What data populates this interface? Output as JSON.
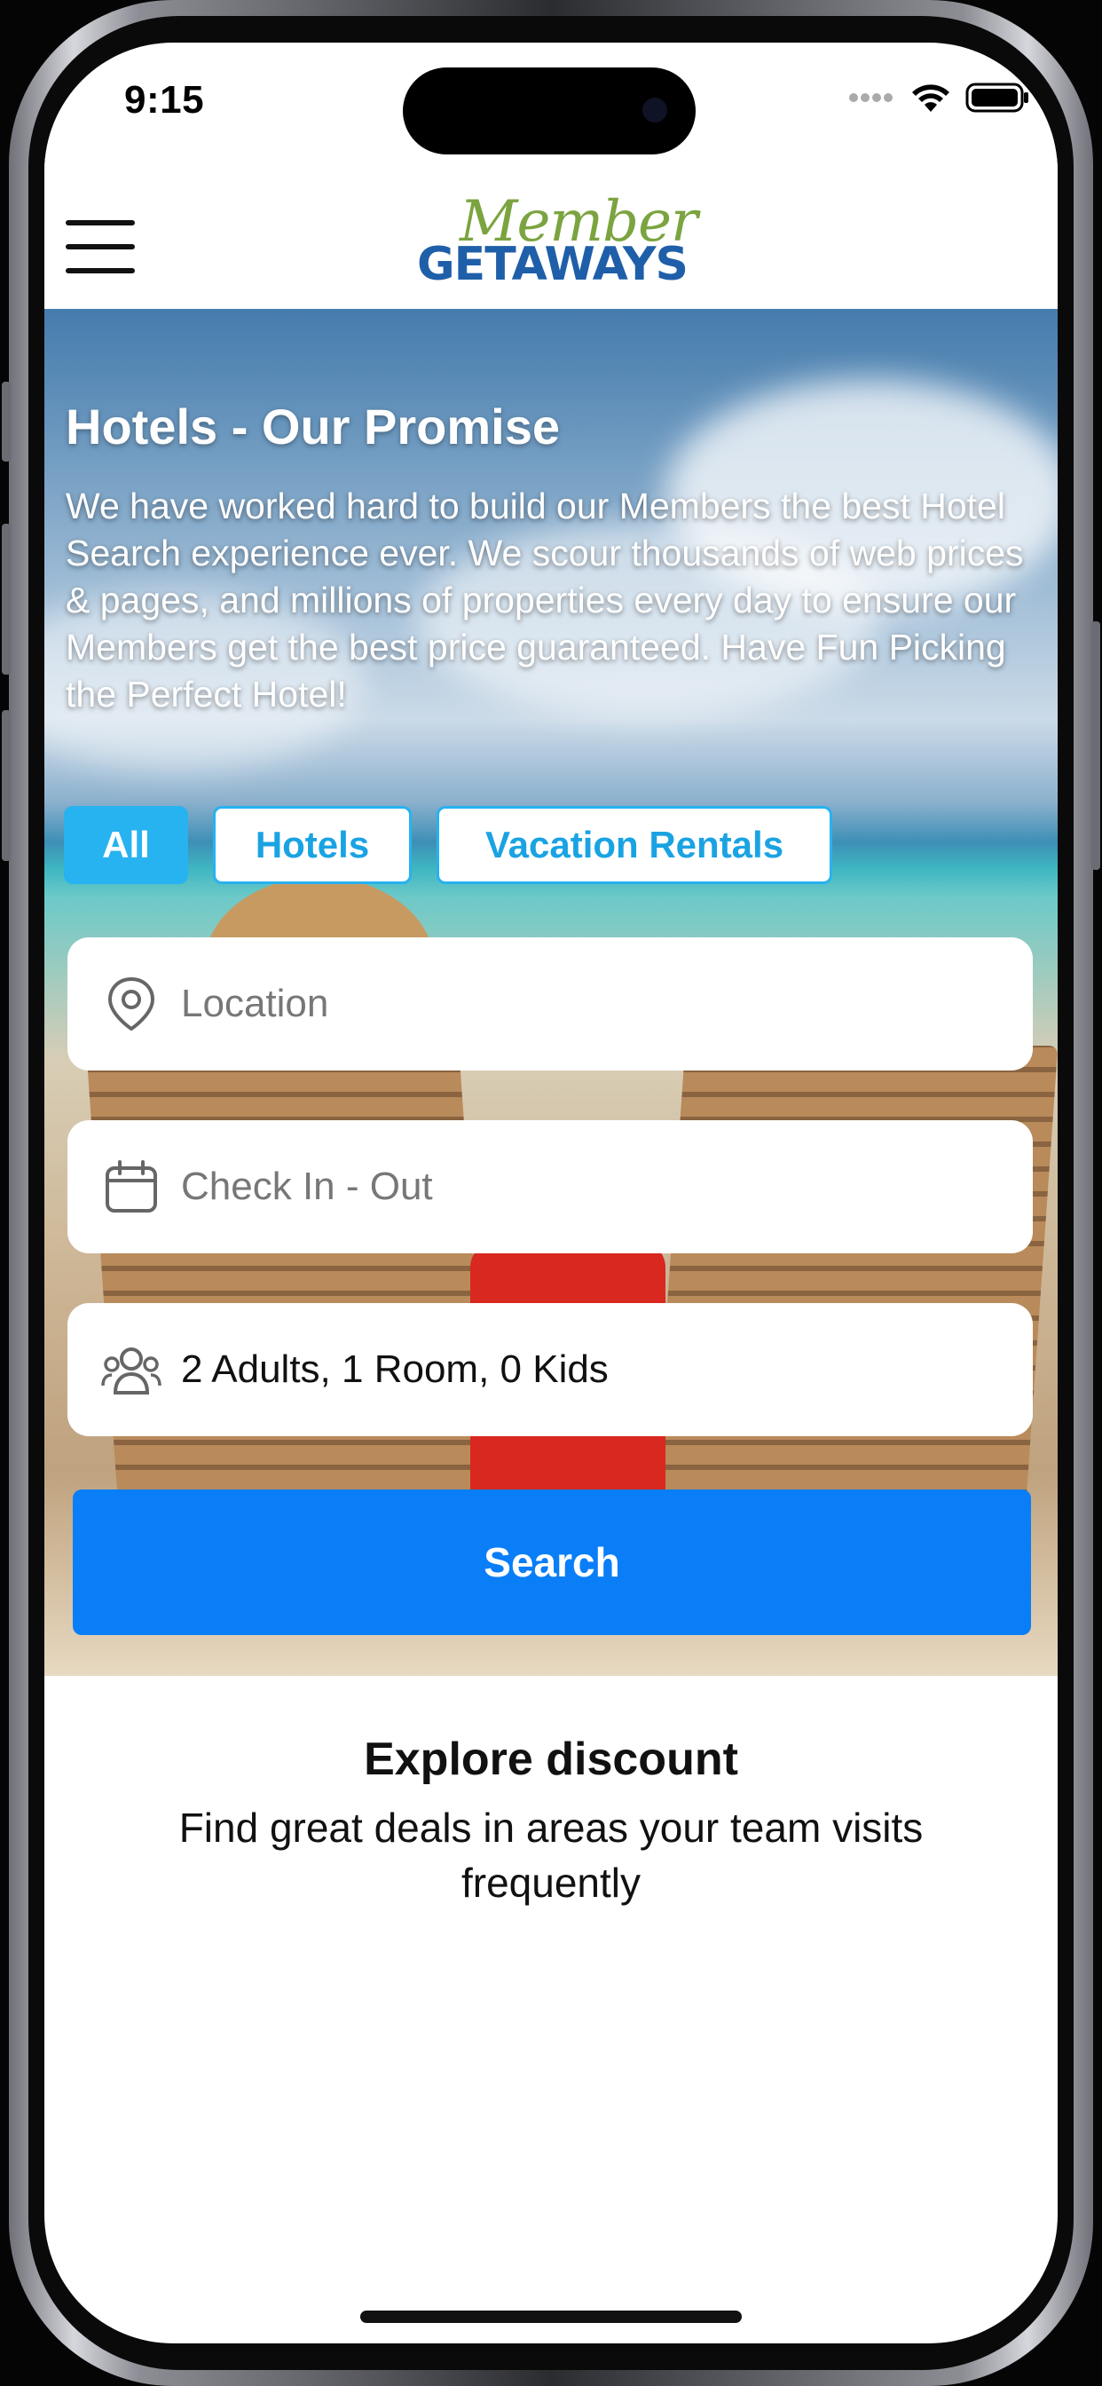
{
  "status_bar": {
    "time": "9:15",
    "icons": [
      "signal-dots-icon",
      "wifi-icon",
      "battery-icon"
    ]
  },
  "header": {
    "logo_script": "Member",
    "logo_bold": "GETAWAYS",
    "menu_icon": "hamburger-menu-icon"
  },
  "hero": {
    "title": "Hotels - Our Promise",
    "description": "We have worked hard to build our Members the best Hotel Search experience ever. We scour thousands of web prices & pages, and millions of properties every day to ensure our Members get the best price guaranteed. Have Fun Picking the Perfect Hotel!"
  },
  "tabs": [
    {
      "label": "All",
      "active": true
    },
    {
      "label": "Hotels",
      "active": false
    },
    {
      "label": "Vacation Rentals",
      "active": false
    }
  ],
  "search_form": {
    "location_placeholder": "Location",
    "dates_placeholder": "Check In - Out",
    "guests_value": "2 Adults, 1 Room, 0 Kids",
    "search_label": "Search"
  },
  "explore": {
    "title": "Explore discount",
    "subtitle": "Find great deals in areas your team visits frequently"
  },
  "colors": {
    "tab_active": "#27b2f0",
    "search_button": "#0a7ef7",
    "logo_green": "#7ba440",
    "logo_blue": "#1f5fa9"
  }
}
